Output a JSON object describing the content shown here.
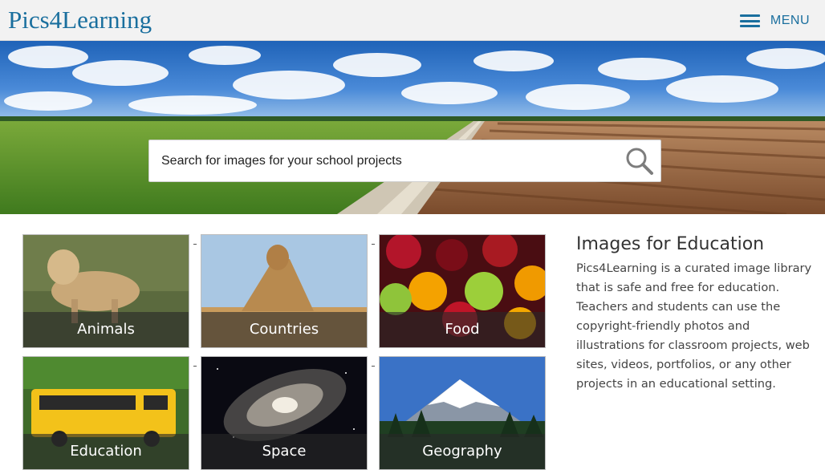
{
  "header": {
    "logo": "Pics4Learning",
    "menu_label": "MENU",
    "accent_color": "#1a6f9e"
  },
  "search": {
    "placeholder": "Search for images for your school projects",
    "value": ""
  },
  "categories": [
    {
      "label": "Animals"
    },
    {
      "label": "Countries"
    },
    {
      "label": "Food"
    },
    {
      "label": "Education"
    },
    {
      "label": "Space"
    },
    {
      "label": "Geography"
    }
  ],
  "info": {
    "title": "Images for Education",
    "body": "Pics4Learning is a curated image library that is safe and free for education. Teachers and students can use the copyright-friendly photos and illustrations for classroom projects, web sites, videos, portfolios, or any other projects in an educational setting."
  }
}
